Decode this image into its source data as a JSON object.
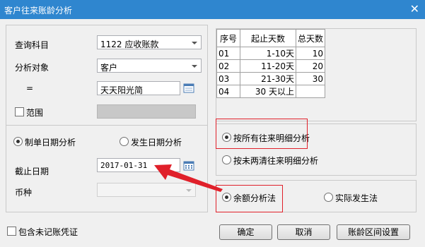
{
  "window": {
    "title": "客户往来账龄分析"
  },
  "query": {
    "subject_label": "查询科目",
    "subject_value": "1122 应收账款",
    "object_label": "分析对象",
    "object_value": "客户",
    "equals_label": "=",
    "equals_value": "天天阳光简",
    "range_label": "范围"
  },
  "date_options": {
    "option1": "制单日期分析",
    "option2": "发生日期分析",
    "deadline_label": "截止日期",
    "deadline_value": "2017-01-31",
    "currency_label": "币种",
    "currency_value": ""
  },
  "table": {
    "headers": [
      "序号",
      "起止天数",
      "总天数"
    ],
    "rows": [
      {
        "no": "01",
        "range": "1-10天",
        "total": "10"
      },
      {
        "no": "02",
        "range": "11-20天",
        "total": "20"
      },
      {
        "no": "03",
        "range": "21-30天",
        "total": "30"
      },
      {
        "no": "04",
        "range": "30 天以上",
        "total": ""
      }
    ]
  },
  "detail_options": {
    "option1": "按所有往来明细分析",
    "option2": "按未两清往来明细分析"
  },
  "method_options": {
    "option1": "余额分析法",
    "option2": "实际发生法"
  },
  "footer": {
    "include_unposted": "包含未记账凭证",
    "ok": "确定",
    "cancel": "取消",
    "interval_settings": "账龄区间设置"
  },
  "colors": {
    "titlebar": "#2f86cf",
    "highlight": "#e0202a"
  }
}
